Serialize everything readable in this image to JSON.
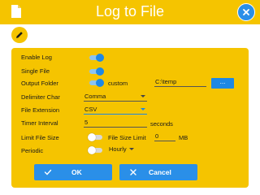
{
  "window": {
    "title": "Log to File"
  },
  "colors": {
    "accent": "#f5c400",
    "primary": "#1e88e5"
  },
  "icons": {
    "window": "document-icon",
    "close": "close-icon",
    "edit": "pencil-icon",
    "ok": "check-icon",
    "cancel": "x-icon"
  },
  "settings": {
    "enable_log": {
      "label": "Enable Log",
      "value": true
    },
    "single_file": {
      "label": "Single File",
      "value": true
    },
    "output_folder": {
      "label": "Output Folder",
      "custom_toggle": true,
      "custom_label": "custom",
      "path": "C:\\temp",
      "browse_label": "..."
    },
    "delimiter_char": {
      "label": "Delimiter Char",
      "value": "Comma"
    },
    "file_extension": {
      "label": "File Extension",
      "value": "CSV"
    },
    "timer_interval": {
      "label": "Timer Interval",
      "value": "5",
      "unit": "seconds"
    },
    "limit_file_size": {
      "label": "Limit File Size",
      "toggle": false,
      "size_label": "File Size Limit",
      "size_value": "0",
      "size_unit": "MB"
    },
    "periodic": {
      "label": "Periodic",
      "toggle": false,
      "value": "Hourly"
    }
  },
  "buttons": {
    "ok": "OK",
    "cancel": "Cancel"
  }
}
